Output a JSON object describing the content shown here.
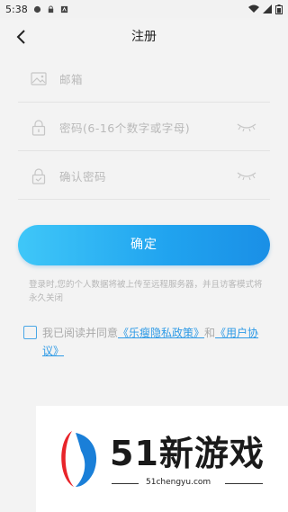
{
  "status_bar": {
    "time": "5:38"
  },
  "header": {
    "title": "注册"
  },
  "form": {
    "email_placeholder": "邮箱",
    "password_placeholder": "密码(6-16个数字或字母)",
    "confirm_placeholder": "确认密码"
  },
  "confirm_button": "确定",
  "notice": "登录时,您的个人数据将被上传至远程服务器，并且访客模式将永久关闭",
  "agreement": {
    "prefix": "我已阅读并同意",
    "privacy_link": "《乐瘦隐私政策》",
    "and": "和",
    "user_link": "《用户协议》"
  },
  "watermark": {
    "brand": "51新游戏",
    "url": "51chengyu.com"
  },
  "colors": {
    "accent": "#20a3ef",
    "link": "#2e9ae6"
  }
}
